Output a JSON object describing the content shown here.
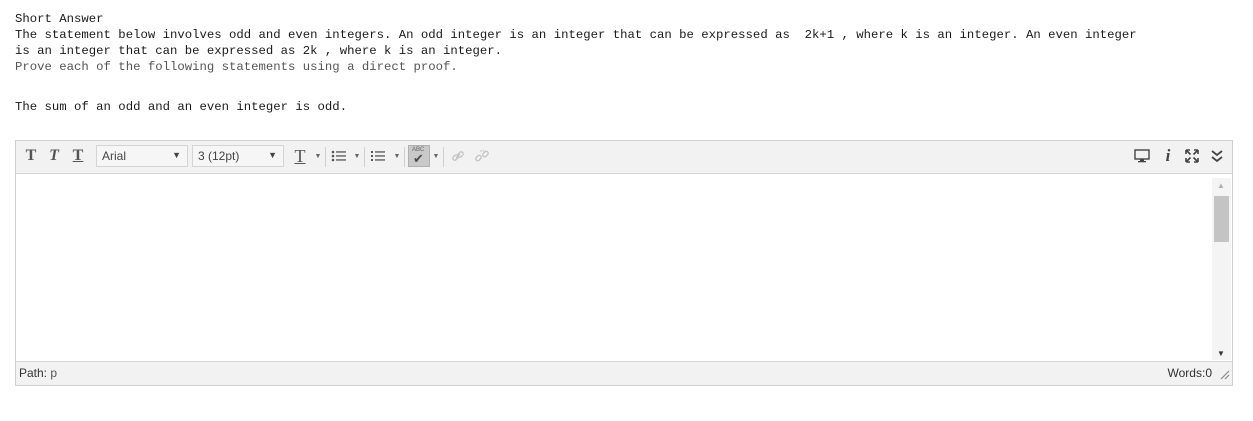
{
  "question": {
    "type_label": "Short Answer",
    "intro_line1": "The statement below involves odd and even integers. An odd integer is an integer that can be expressed as  2k+1 , where k is an integer. An even integer",
    "intro_line2": "is an integer that can be expressed as 2k , where k is an integer.",
    "instruction": "Prove each of the following statements using a direct proof.",
    "statement": "The sum of an odd and an even integer is odd."
  },
  "toolbar": {
    "bold_icon": "T",
    "italic_icon": "T",
    "underline_icon": "T",
    "font_family": "Arial",
    "font_size": "3 (12pt)",
    "text_color_icon": "T",
    "spellcheck_abc": "ABC"
  },
  "status": {
    "path_label": "Path:",
    "path_value": "p",
    "words_label": "Words:",
    "words_count": "0"
  },
  "colors": {
    "toolbar_bg": "#f2f2f2",
    "border": "#cfcfcf",
    "spell_active": "#c9c9c9"
  },
  "icons": [
    "bold-icon",
    "italic-icon",
    "underline-icon",
    "text-color-icon",
    "bullet-list-icon",
    "numbered-list-icon",
    "spellcheck-icon",
    "insert-link-icon",
    "unlink-icon",
    "preview-icon",
    "info-icon",
    "fullscreen-icon",
    "expand-toolbar-icon"
  ]
}
